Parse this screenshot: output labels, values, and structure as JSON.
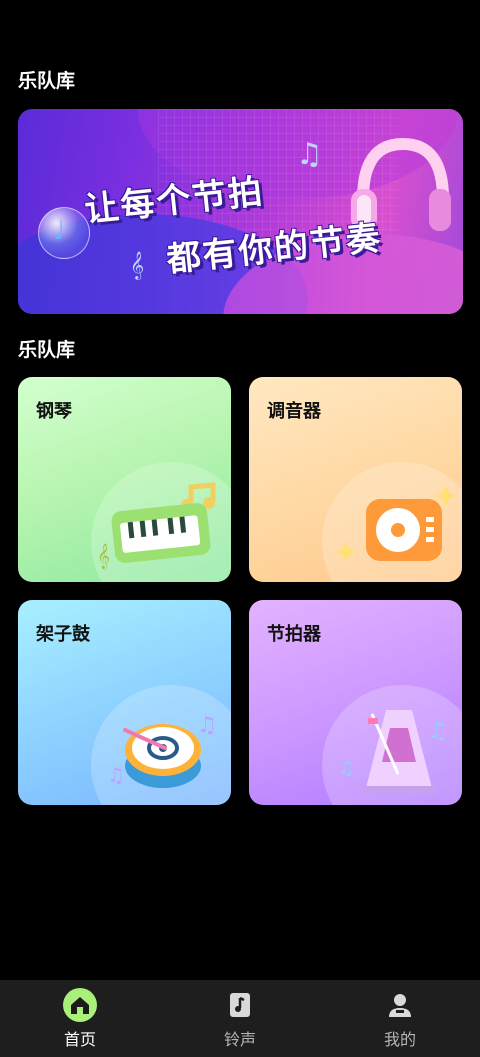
{
  "sections": {
    "top_title": "乐队库",
    "mid_title": "乐队库"
  },
  "banner": {
    "line1": "让每个节拍",
    "line2": "都有你的节奏"
  },
  "cards": [
    {
      "label": "钢琴",
      "icon": "piano-icon"
    },
    {
      "label": "调音器",
      "icon": "turntable-icon"
    },
    {
      "label": "架子鼓",
      "icon": "drum-icon"
    },
    {
      "label": "节拍器",
      "icon": "metronome-icon"
    }
  ],
  "tabbar": {
    "items": [
      {
        "label": "首页",
        "icon": "home-icon",
        "active": true
      },
      {
        "label": "铃声",
        "icon": "music-note-icon",
        "active": false
      },
      {
        "label": "我的",
        "icon": "user-icon",
        "active": false
      }
    ],
    "active_color": "#a8f07a"
  }
}
